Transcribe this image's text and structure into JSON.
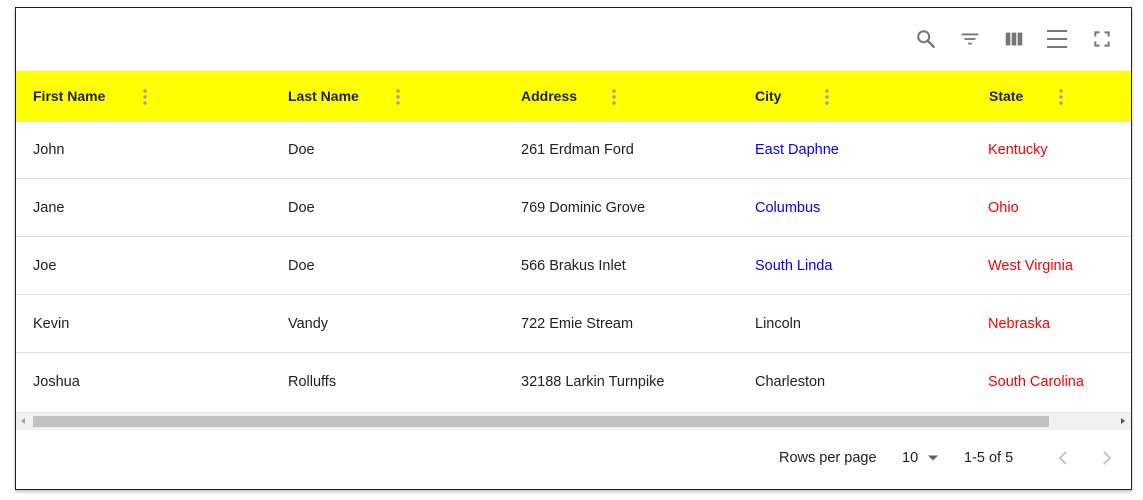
{
  "toolbar": {
    "icons": [
      "search-icon",
      "filter-icon",
      "view-columns-icon",
      "density-icon",
      "fullscreen-icon"
    ]
  },
  "table": {
    "columns": [
      {
        "label": "First Name"
      },
      {
        "label": "Last Name"
      },
      {
        "label": "Address"
      },
      {
        "label": "City"
      },
      {
        "label": "State"
      }
    ],
    "rows": [
      [
        "John",
        "Doe",
        "261 Erdman Ford",
        "East Daphne",
        "Kentucky"
      ],
      [
        "Jane",
        "Doe",
        "769 Dominic Grove",
        "Columbus",
        "Ohio"
      ],
      [
        "Joe",
        "Doe",
        "566 Brakus Inlet",
        "South Linda",
        "West Virginia"
      ],
      [
        "Kevin",
        "Vandy",
        "722 Emie Stream",
        "Lincoln",
        "Nebraska"
      ],
      [
        "Joshua",
        "Rolluffs",
        "32188 Larkin Turnpike",
        "Charleston",
        "South Carolina"
      ]
    ],
    "city_colors": [
      "#0000ff",
      "#0000ff",
      "#0000ff",
      "#212121",
      "#212121"
    ],
    "state_color": "#ff0000",
    "header_bg": "#ffff00"
  },
  "pagination": {
    "rows_per_page_label": "Rows per page",
    "rows_per_page_value": "10",
    "range_label": "1-5 of 5"
  }
}
